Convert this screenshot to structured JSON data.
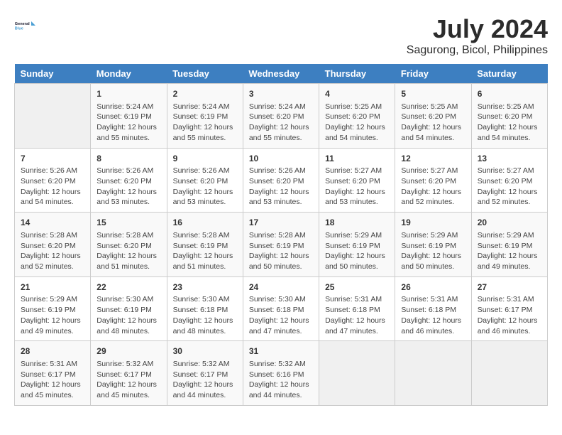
{
  "header": {
    "logo_line1": "General",
    "logo_line2": "Blue",
    "main_title": "July 2024",
    "subtitle": "Sagurong, Bicol, Philippines"
  },
  "days_of_week": [
    "Sunday",
    "Monday",
    "Tuesday",
    "Wednesday",
    "Thursday",
    "Friday",
    "Saturday"
  ],
  "weeks": [
    [
      {
        "num": "",
        "info": ""
      },
      {
        "num": "1",
        "info": "Sunrise: 5:24 AM\nSunset: 6:19 PM\nDaylight: 12 hours\nand 55 minutes."
      },
      {
        "num": "2",
        "info": "Sunrise: 5:24 AM\nSunset: 6:19 PM\nDaylight: 12 hours\nand 55 minutes."
      },
      {
        "num": "3",
        "info": "Sunrise: 5:24 AM\nSunset: 6:20 PM\nDaylight: 12 hours\nand 55 minutes."
      },
      {
        "num": "4",
        "info": "Sunrise: 5:25 AM\nSunset: 6:20 PM\nDaylight: 12 hours\nand 54 minutes."
      },
      {
        "num": "5",
        "info": "Sunrise: 5:25 AM\nSunset: 6:20 PM\nDaylight: 12 hours\nand 54 minutes."
      },
      {
        "num": "6",
        "info": "Sunrise: 5:25 AM\nSunset: 6:20 PM\nDaylight: 12 hours\nand 54 minutes."
      }
    ],
    [
      {
        "num": "7",
        "info": "Sunrise: 5:26 AM\nSunset: 6:20 PM\nDaylight: 12 hours\nand 54 minutes."
      },
      {
        "num": "8",
        "info": "Sunrise: 5:26 AM\nSunset: 6:20 PM\nDaylight: 12 hours\nand 53 minutes."
      },
      {
        "num": "9",
        "info": "Sunrise: 5:26 AM\nSunset: 6:20 PM\nDaylight: 12 hours\nand 53 minutes."
      },
      {
        "num": "10",
        "info": "Sunrise: 5:26 AM\nSunset: 6:20 PM\nDaylight: 12 hours\nand 53 minutes."
      },
      {
        "num": "11",
        "info": "Sunrise: 5:27 AM\nSunset: 6:20 PM\nDaylight: 12 hours\nand 53 minutes."
      },
      {
        "num": "12",
        "info": "Sunrise: 5:27 AM\nSunset: 6:20 PM\nDaylight: 12 hours\nand 52 minutes."
      },
      {
        "num": "13",
        "info": "Sunrise: 5:27 AM\nSunset: 6:20 PM\nDaylight: 12 hours\nand 52 minutes."
      }
    ],
    [
      {
        "num": "14",
        "info": "Sunrise: 5:28 AM\nSunset: 6:20 PM\nDaylight: 12 hours\nand 52 minutes."
      },
      {
        "num": "15",
        "info": "Sunrise: 5:28 AM\nSunset: 6:20 PM\nDaylight: 12 hours\nand 51 minutes."
      },
      {
        "num": "16",
        "info": "Sunrise: 5:28 AM\nSunset: 6:19 PM\nDaylight: 12 hours\nand 51 minutes."
      },
      {
        "num": "17",
        "info": "Sunrise: 5:28 AM\nSunset: 6:19 PM\nDaylight: 12 hours\nand 50 minutes."
      },
      {
        "num": "18",
        "info": "Sunrise: 5:29 AM\nSunset: 6:19 PM\nDaylight: 12 hours\nand 50 minutes."
      },
      {
        "num": "19",
        "info": "Sunrise: 5:29 AM\nSunset: 6:19 PM\nDaylight: 12 hours\nand 50 minutes."
      },
      {
        "num": "20",
        "info": "Sunrise: 5:29 AM\nSunset: 6:19 PM\nDaylight: 12 hours\nand 49 minutes."
      }
    ],
    [
      {
        "num": "21",
        "info": "Sunrise: 5:29 AM\nSunset: 6:19 PM\nDaylight: 12 hours\nand 49 minutes."
      },
      {
        "num": "22",
        "info": "Sunrise: 5:30 AM\nSunset: 6:19 PM\nDaylight: 12 hours\nand 48 minutes."
      },
      {
        "num": "23",
        "info": "Sunrise: 5:30 AM\nSunset: 6:18 PM\nDaylight: 12 hours\nand 48 minutes."
      },
      {
        "num": "24",
        "info": "Sunrise: 5:30 AM\nSunset: 6:18 PM\nDaylight: 12 hours\nand 47 minutes."
      },
      {
        "num": "25",
        "info": "Sunrise: 5:31 AM\nSunset: 6:18 PM\nDaylight: 12 hours\nand 47 minutes."
      },
      {
        "num": "26",
        "info": "Sunrise: 5:31 AM\nSunset: 6:18 PM\nDaylight: 12 hours\nand 46 minutes."
      },
      {
        "num": "27",
        "info": "Sunrise: 5:31 AM\nSunset: 6:17 PM\nDaylight: 12 hours\nand 46 minutes."
      }
    ],
    [
      {
        "num": "28",
        "info": "Sunrise: 5:31 AM\nSunset: 6:17 PM\nDaylight: 12 hours\nand 45 minutes."
      },
      {
        "num": "29",
        "info": "Sunrise: 5:32 AM\nSunset: 6:17 PM\nDaylight: 12 hours\nand 45 minutes."
      },
      {
        "num": "30",
        "info": "Sunrise: 5:32 AM\nSunset: 6:17 PM\nDaylight: 12 hours\nand 44 minutes."
      },
      {
        "num": "31",
        "info": "Sunrise: 5:32 AM\nSunset: 6:16 PM\nDaylight: 12 hours\nand 44 minutes."
      },
      {
        "num": "",
        "info": ""
      },
      {
        "num": "",
        "info": ""
      },
      {
        "num": "",
        "info": ""
      }
    ]
  ]
}
